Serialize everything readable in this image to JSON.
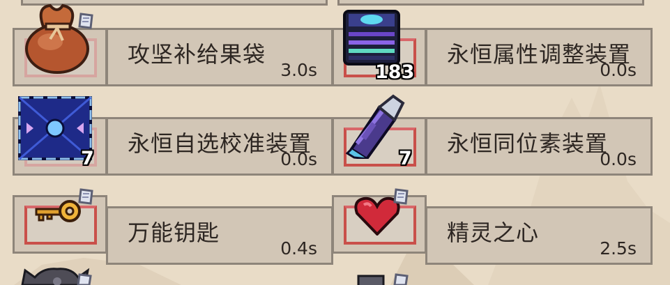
{
  "items": [
    {
      "name": "攻坚补给果袋",
      "time": "3.0s",
      "count": "",
      "icon": "treasure-bag-icon"
    },
    {
      "name": "永恒属性调整装置",
      "time": "0.0s",
      "count": "183",
      "icon": "cyber-cube-icon"
    },
    {
      "name": "永恒自选校准装置",
      "time": "0.0s",
      "count": "7",
      "icon": "calibration-panel-icon"
    },
    {
      "name": "永恒同位素装置",
      "time": "0.0s",
      "count": "7",
      "icon": "isotope-capsule-icon"
    },
    {
      "name": "万能钥匙",
      "time": "0.4s",
      "count": "",
      "icon": "key-icon"
    },
    {
      "name": "精灵之心",
      "time": "2.5s",
      "count": "",
      "icon": "heart-icon"
    }
  ],
  "colors": {
    "panel": "#d2c6b6",
    "border": "#8e857a",
    "frame": "#c9504a"
  }
}
